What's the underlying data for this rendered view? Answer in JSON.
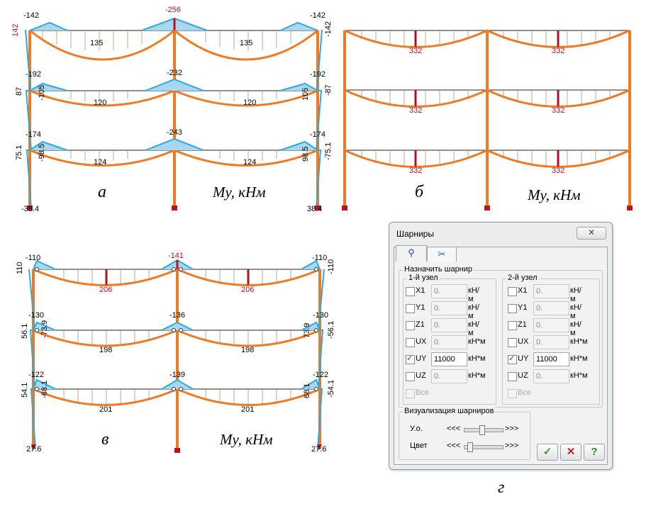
{
  "panels": {
    "a": {
      "letter": "а",
      "unit": "My, кНм",
      "top": {
        "left_end": "-142",
        "mid": "-256",
        "right_end": "-142",
        "span_left": "135",
        "span_right": "135",
        "col_left": "142",
        "col_right": "-142"
      },
      "mid": {
        "left_end": "-192",
        "left_col": "-105",
        "mid": "-232",
        "right_end": "-192",
        "right_col": "105",
        "span_left": "120",
        "span_right": "120",
        "col_left_out": "87",
        "col_right_out": "-87"
      },
      "bot": {
        "left_end": "-174",
        "left_col": "-98.5",
        "mid": "-243",
        "right_end": "-174",
        "right_col": "98.5",
        "span_left": "124",
        "span_right": "124",
        "col_left_out": "75.1",
        "col_right_out": "-75.1"
      },
      "base": {
        "left": "-38.4",
        "right": "38.4"
      }
    },
    "b": {
      "letter": "б",
      "unit": "My, кНм",
      "spans": [
        "332",
        "332",
        "332",
        "332",
        "332",
        "332"
      ]
    },
    "v": {
      "letter": "в",
      "unit": "My, кНм",
      "top": {
        "left_end": "-110",
        "mid": "-141",
        "right_end": "-110",
        "span_left": "206",
        "span_right": "206",
        "col_left": "110",
        "col_right": "-110"
      },
      "mid": {
        "left_end": "-130",
        "left_col": "-73.9",
        "mid": "-136",
        "right_end": "-130",
        "right_col": "73.9",
        "span_left": "198",
        "span_right": "198",
        "col_left_out": "56.1",
        "col_right_out": "-56.1"
      },
      "bot": {
        "left_end": "-122",
        "left_col": "-68.1",
        "mid": "-139",
        "right_end": "-122",
        "right_col": "68.1",
        "span_left": "201",
        "span_right": "201",
        "col_left_out": "54.1",
        "col_right_out": "-54.1"
      },
      "base": {
        "left": "27.6",
        "right": "27.6"
      }
    }
  },
  "caption_g": "г",
  "dialog": {
    "title": "Шарниры",
    "close_glyph": "✕",
    "tabs": [
      {
        "icon": "hinge-icon"
      },
      {
        "icon": "scissors-icon"
      }
    ],
    "group_assign": "Назначить шарнир",
    "node1": {
      "title": "1-й узел",
      "rows": [
        {
          "label": "X1",
          "value": "0.",
          "unit": "кН/м",
          "checked": false
        },
        {
          "label": "Y1",
          "value": "0.",
          "unit": "кН/м",
          "checked": false
        },
        {
          "label": "Z1",
          "value": "0.",
          "unit": "кН/м",
          "checked": false
        },
        {
          "label": "UX",
          "value": "0.",
          "unit": "кН*м",
          "checked": false
        },
        {
          "label": "UY",
          "value": "11000",
          "unit": "кН*м",
          "checked": true
        },
        {
          "label": "UZ",
          "value": "0.",
          "unit": "кН*м",
          "checked": false
        }
      ],
      "all": "Все"
    },
    "node2": {
      "title": "2-й узел",
      "rows": [
        {
          "label": "X1",
          "value": "0.",
          "unit": "кН/м",
          "checked": false
        },
        {
          "label": "Y1",
          "value": "0.",
          "unit": "кН/м",
          "checked": false
        },
        {
          "label": "Z1",
          "value": "0.",
          "unit": "кН/м",
          "checked": false
        },
        {
          "label": "UX",
          "value": "0.",
          "unit": "кН*м",
          "checked": false
        },
        {
          "label": "UY",
          "value": "11000",
          "unit": "кН*м",
          "checked": true
        },
        {
          "label": "UZ",
          "value": "0.",
          "unit": "кН*м",
          "checked": false
        }
      ],
      "all": "Все"
    },
    "group_vis": "Визуализация шарниров",
    "vis_rows": [
      {
        "label": "У.о.",
        "left": "<<<",
        "right": ">>>",
        "level": 0.45
      },
      {
        "label": "Цвет",
        "left": "<<<",
        "right": ">>>",
        "level": 0.1
      }
    ],
    "buttons": {
      "ok": "✓",
      "cancel": "✕",
      "help": "?"
    },
    "colors": {
      "ok": "#3c9a2c",
      "cancel": "#c8202a",
      "help": "#2c8a2c"
    }
  },
  "colors": {
    "frame": "#f07a22",
    "moment": "#2ea8e0",
    "beam": "#d4622a",
    "red": "#c0101c",
    "hatch": "#b08060"
  }
}
